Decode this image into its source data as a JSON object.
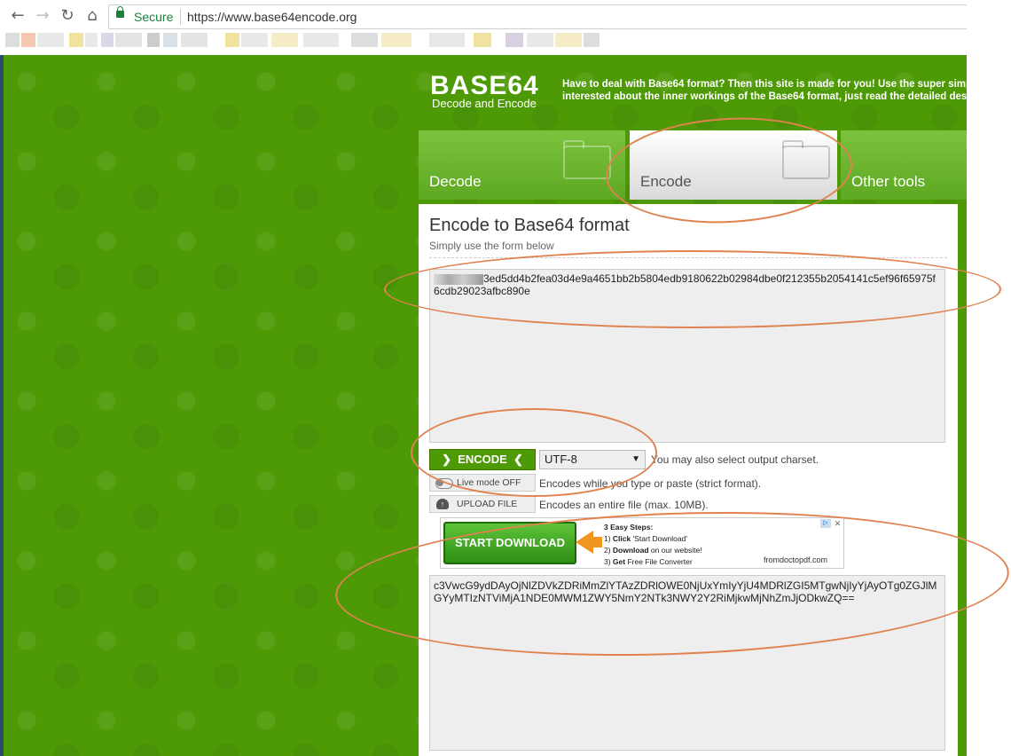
{
  "browser": {
    "back_icon": "back-arrow-icon",
    "forward_icon": "forward-arrow-icon",
    "reload_icon": "reload-icon",
    "home_icon": "home-icon",
    "secure_label": "Secure",
    "url": "https://www.base64encode.org"
  },
  "header": {
    "logo_title": "BASE64",
    "logo_subtitle": "Decode and Encode",
    "intro_line1": "Have to deal with Base64 format? Then this site is made for you! Use the super simp",
    "intro_line2": "interested about the inner workings of the Base64 format, just read the detailed descrip"
  },
  "tabs": [
    {
      "label": "Decode",
      "active": false
    },
    {
      "label": "Encode",
      "active": true
    },
    {
      "label": "Other tools",
      "active": false
    }
  ],
  "panel": {
    "title": "Encode to Base64 format",
    "subtitle": "Simply use the form below",
    "input_text": "3ed5dd4b2fea03d4e9a4651bb2b5804edb9180622b02984dbe0f212355b2054141c5ef96f65975f6cdb29023afbc890e",
    "encode_button": "ENCODE",
    "charset_value": "UTF-8",
    "charset_note": "You may also select output charset.",
    "live_mode_button": "Live mode OFF",
    "live_mode_note": "Encodes while you type or paste (strict format).",
    "upload_button": "UPLOAD FILE",
    "upload_note": "Encodes an entire file (max. 10MB).",
    "output_text": "c3VwcG9ydDAyOjNlZDVkZDRiMmZlYTAzZDRlOWE0NjUxYmIyYjU4MDRlZGI5MTgwNjIyYjAyOTg0ZGJlMGYyMTIzNTViMjA1NDE0MWM1ZWY5NmY2NTk3NWY2Y2RiMjkwMjNhZmJjODkwZQ=="
  },
  "ad": {
    "button": "START DOWNLOAD",
    "steps_title": "3 Easy Steps:",
    "step1_prefix": "1) ",
    "step1_bold": "Click",
    "step1_rest": " 'Start Download'",
    "step2_prefix": "2) ",
    "step2_bold": "Download",
    "step2_rest": " on our website!",
    "step3_prefix": "3) ",
    "step3_bold": "Get",
    "step3_rest": " Free File Converter",
    "site": "fromdoctopdf.com"
  },
  "colors": {
    "green": "#4e9a06",
    "annotation": "#e0824f"
  }
}
